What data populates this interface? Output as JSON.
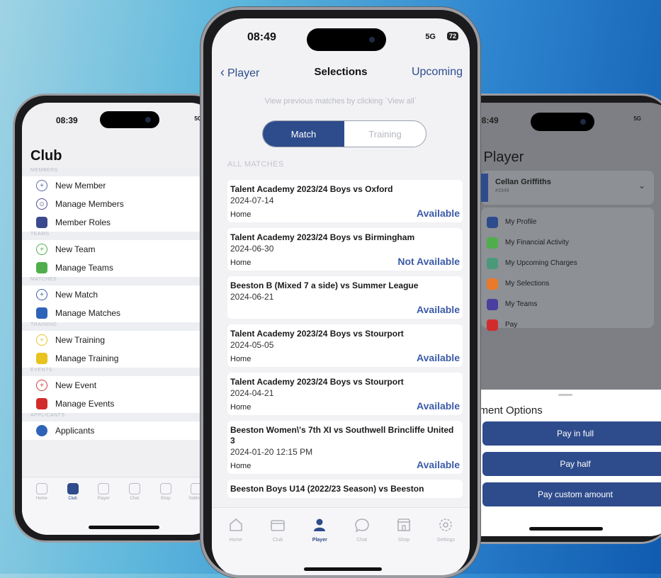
{
  "left": {
    "time": "08:39",
    "signal": "5G",
    "title": "Club",
    "groups": [
      {
        "label": "MEMBERS",
        "items": [
          {
            "label": "New Member",
            "icon": "plus-circle-icon",
            "color": "#5a68a8"
          },
          {
            "label": "Manage Members",
            "icon": "person-circle-icon",
            "color": "#4a4f8e"
          },
          {
            "label": "Member Roles",
            "icon": "briefcase-icon",
            "color": "#3b4a8f"
          }
        ]
      },
      {
        "label": "TEAMS",
        "items": [
          {
            "label": "New Team",
            "icon": "plus-circle-icon",
            "color": "#4fae4b"
          },
          {
            "label": "Manage Teams",
            "icon": "people-icon",
            "color": "#4fae4b"
          }
        ]
      },
      {
        "label": "MATCHES",
        "items": [
          {
            "label": "New Match",
            "icon": "plus-circle-icon",
            "color": "#3a5fb0"
          },
          {
            "label": "Manage Matches",
            "icon": "briefcase-icon",
            "color": "#2e64b8"
          }
        ]
      },
      {
        "label": "TRAINING",
        "items": [
          {
            "label": "New Training",
            "icon": "plus-circle-icon",
            "color": "#e6c42b"
          },
          {
            "label": "Manage Training",
            "icon": "briefcase-icon",
            "color": "#e8c21f"
          }
        ]
      },
      {
        "label": "EVENTS",
        "items": [
          {
            "label": "New Event",
            "icon": "plus-circle-icon",
            "color": "#d23c3c"
          },
          {
            "label": "Manage Events",
            "icon": "briefcase-icon",
            "color": "#d12c2c"
          }
        ]
      },
      {
        "label": "APPLICANTS",
        "items": [
          {
            "label": "Applicants",
            "icon": "globe-icon",
            "color": "#2e64b8"
          }
        ]
      }
    ],
    "tabs": [
      "Home",
      "Club",
      "Player",
      "Chat",
      "Shop",
      "Settings"
    ]
  },
  "center": {
    "time": "08:49",
    "signal": "5G",
    "battery": "72",
    "back_label": "Player",
    "title": "Selections",
    "upcoming_label": "Upcoming",
    "hint": "View previous matches by clicking `View all`",
    "segments": [
      "Match",
      "Training"
    ],
    "section_label": "ALL MATCHES",
    "matches": [
      {
        "name": "Talent Academy 2023/24 Boys vs Oxford",
        "date": "2024-07-14",
        "location": "Home",
        "status": "Available"
      },
      {
        "name": "Talent Academy 2023/24 Boys vs Birmingham",
        "date": "2024-06-30",
        "location": "Home",
        "status": "Not Available"
      },
      {
        "name": "Beeston B (Mixed 7 a side) vs Summer League",
        "date": "2024-06-21",
        "location": "",
        "status": "Available"
      },
      {
        "name": "Talent Academy 2023/24 Boys vs Stourport",
        "date": "2024-05-05",
        "location": "Home",
        "status": "Available"
      },
      {
        "name": "Talent Academy 2023/24 Boys vs Stourport",
        "date": "2024-04-21",
        "location": "Home",
        "status": "Available"
      },
      {
        "name": "Beeston Women\\'s 7th XI vs Southwell Brincliffe United 3",
        "date": "2024-01-20 12:15 PM",
        "location": "Home",
        "status": "Available"
      },
      {
        "name": "Beeston Boys U14 (2022/23 Season) vs Beeston",
        "date": "",
        "location": "",
        "status": ""
      }
    ],
    "tabs": [
      "Home",
      "Club",
      "Player",
      "Chat",
      "Shop",
      "Settings"
    ],
    "active_tab": "Player"
  },
  "right": {
    "time": "08:49",
    "signal": "5G",
    "title": "y Player",
    "player_name": "Cellan Griffiths",
    "player_sub": "#3349",
    "menu": [
      {
        "label": "My Profile",
        "color": "#2e4c8c"
      },
      {
        "label": "My Financial Activity",
        "color": "#4fae4b"
      },
      {
        "label": "My Upcoming Charges",
        "color": "#4a9a7a"
      },
      {
        "label": "My Selections",
        "color": "#e87a2a"
      },
      {
        "label": "My Teams",
        "color": "#4a3f9e"
      },
      {
        "label": "Pay",
        "color": "#d12c2c"
      }
    ],
    "sheet_title": "yment Options",
    "buttons": [
      "Pay in full",
      "Pay half",
      "Pay custom amount"
    ]
  },
  "colors": {
    "brand": "#2e4c8c",
    "status": "#3b5ba8"
  }
}
